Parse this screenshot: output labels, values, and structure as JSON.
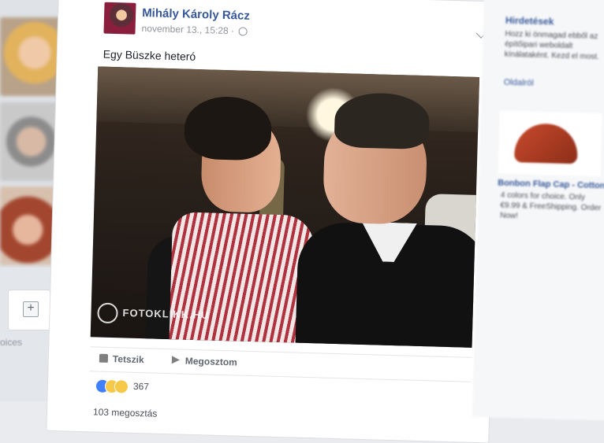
{
  "post": {
    "author": "Mihály Károly Rácz",
    "timestamp": "november 13., 15:28 ·",
    "text": "Egy Büszke heteró",
    "photo_watermark": "FOTOKLIKK.HU",
    "actions": {
      "like": "Tetszik",
      "share": "Megosztom"
    },
    "reactions_count": "367",
    "shares": "103 megosztás"
  },
  "left_column": {
    "add_button": "+",
    "choices_label": "oices"
  },
  "right_column": {
    "title": "Hirdetések",
    "text": "Hozz ki önmagad ebből az építőipari weboldalt kínálataként. Kezd el most.",
    "link": "Oldalról",
    "product_title": "Bonbon Flap Cap - Cotton",
    "product_sub": "4 colors for choice. Only €9.99 & FreeShipping. Order Now!"
  },
  "colors": {
    "link_blue": "#365899",
    "like_blue": "#4080ff",
    "page_bg": "#e9ebee"
  },
  "icons": [
    "globe-icon",
    "chevron-down-icon",
    "thumb-icon",
    "share-icon"
  ]
}
